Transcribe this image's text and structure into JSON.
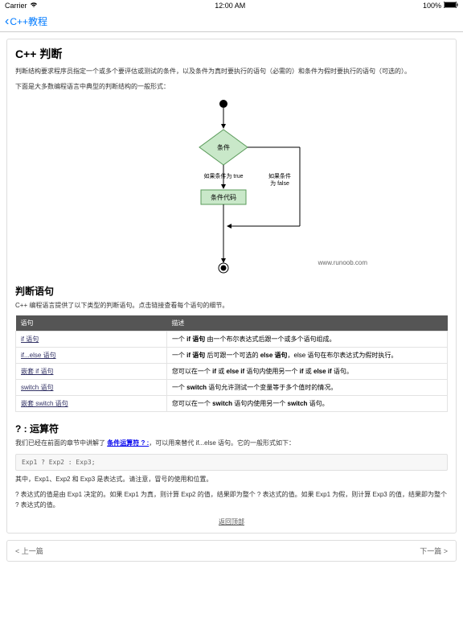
{
  "status": {
    "carrier": "Carrier",
    "time": "12:00 AM",
    "battery": "100%"
  },
  "nav": {
    "back_label": "C++教程"
  },
  "page": {
    "title": "C++ 判断",
    "intro1": "判断结构要求程序员指定一个或多个要评估或测试的条件，以及条件为真时要执行的语句（必需的）和条件为假时要执行的语句（可选的）。",
    "intro2": "下面是大多数编程语言中典型的判断结构的一般形式：",
    "diagram": {
      "cond": "条件",
      "true_label": "如果条件为 true",
      "false_label": "如果条件为 false",
      "code_block": "条件代码",
      "watermark": "www.runoob.com"
    },
    "section2_title": "判断语句",
    "section2_intro": "C++ 编程语言提供了以下类型的判断语句。点击链接查看每个语句的细节。",
    "table": {
      "h1": "语句",
      "h2": "描述",
      "rows": [
        {
          "s": "if 语句",
          "d": "一个 if 语句 由一个布尔表达式后跟一个或多个语句组成。"
        },
        {
          "s": "if...else 语句",
          "d": "一个 if 语句 后可跟一个可选的 else 语句，else 语句在布尔表达式为假时执行。"
        },
        {
          "s": "嵌套 if 语句",
          "d": "您可以在一个 if 或 else if 语句内使用另一个 if 或 else if 语句。"
        },
        {
          "s": "switch 语句",
          "d": "一个 switch 语句允许测试一个变量等于多个值时的情况。"
        },
        {
          "s": "嵌套 switch 语句",
          "d": "您可以在一个 switch 语句内使用另一个 switch 语句。"
        }
      ]
    },
    "section3_title": "? : 运算符",
    "section3_p1_a": "我们已经在前面的章节中讲解了 ",
    "section3_p1_link": "条件运算符 ? :",
    "section3_p1_b": "，可以用来替代 if...else 语句。它的一般形式如下：",
    "code": "Exp1 ? Exp2 : Exp3;",
    "section3_p2": "其中，Exp1、Exp2 和 Exp3 是表达式。请注意，冒号的使用和位置。",
    "section3_p3": "? 表达式的值是由 Exp1 决定的。如果 Exp1 为真，则计算 Exp2 的值，结果即为整个 ? 表达式的值。如果 Exp1 为假，则计算 Exp3 的值，结果即为整个 ? 表达式的值。",
    "back_top": "返回顶部",
    "prev": "< 上一篇",
    "next": "下一篇 >"
  }
}
